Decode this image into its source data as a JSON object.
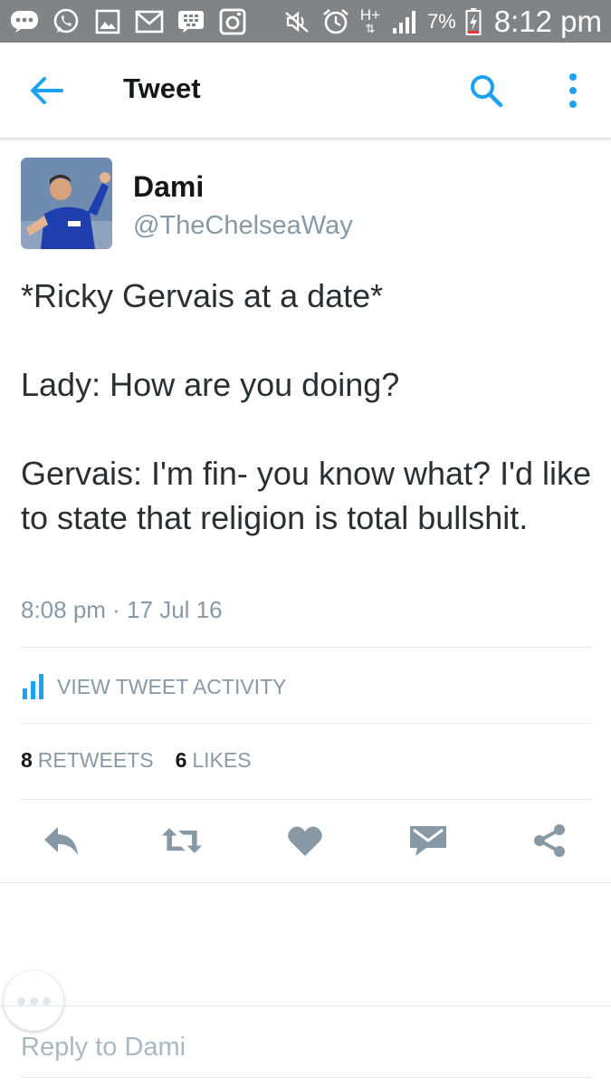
{
  "status_bar": {
    "network_label": "H+",
    "battery_percent": "7%",
    "time": "8:12 pm",
    "icons": [
      "bbm-icon",
      "whatsapp-icon",
      "gallery-icon",
      "gmail-icon",
      "blackberry-icon",
      "instagram-icon",
      "mute-icon",
      "alarm-icon",
      "signal-icon",
      "battery-charging-icon"
    ]
  },
  "app_bar": {
    "title": "Tweet",
    "back_icon": "arrow-left-icon",
    "search_icon": "search-icon",
    "more_icon": "more-vertical-icon"
  },
  "tweet": {
    "author_name": "Dami",
    "author_handle": "@TheChelseaWay",
    "text": "*Ricky Gervais at a date*\n\nLady: How are you doing?\n\nGervais: I'm fin- you know what? I'd like to state that religion is total bullshit.",
    "timestamp": "8:08 pm · 17 Jul 16"
  },
  "activity": {
    "label": "VIEW TWEET ACTIVITY",
    "icon": "bar-chart-icon"
  },
  "stats": {
    "retweets_count": "8",
    "retweets_label": "RETWEETS",
    "likes_count": "6",
    "likes_label": "LIKES"
  },
  "actions": [
    "reply-icon",
    "retweet-icon",
    "like-icon",
    "direct-message-icon",
    "share-icon"
  ],
  "reply_bar": {
    "placeholder": "Reply to Dami"
  },
  "colors": {
    "accent": "#1da1f2",
    "status_bar": "#808487",
    "action_icon": "#8899a6",
    "text_secondary": "#8899a6"
  }
}
